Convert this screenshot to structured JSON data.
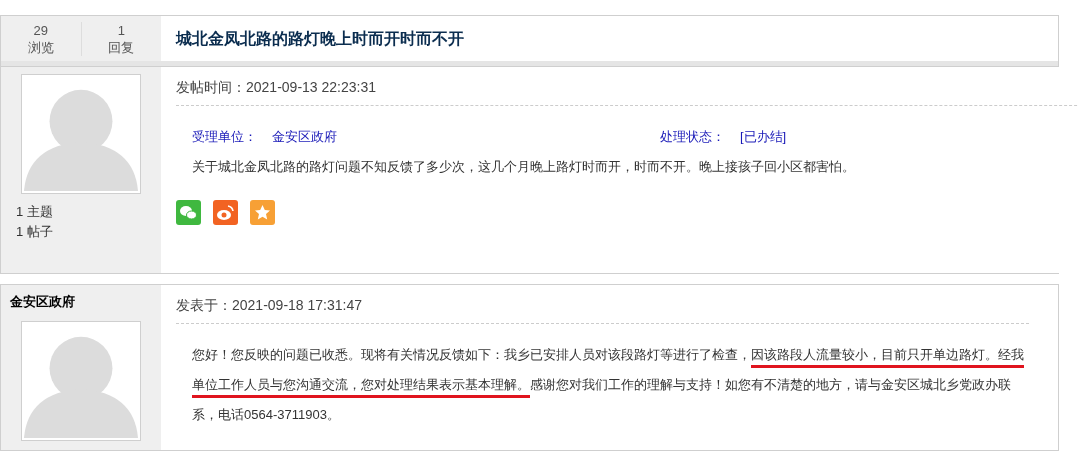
{
  "topic": {
    "stats": [
      {
        "value": "29",
        "label": "浏览"
      },
      {
        "value": "1",
        "label": "回复"
      }
    ],
    "title": "城北金凤北路的路灯晚上时而开时而不开"
  },
  "posts": [
    {
      "author_stats": [
        "1 主题",
        "1 帖子"
      ],
      "time": "发帖时间：2021-09-13 22:23:31",
      "fields": [
        {
          "label": "受理单位：",
          "value": "金安区政府"
        },
        {
          "label": "处理状态：",
          "value": "[已办结]"
        }
      ],
      "body": [
        {
          "text": "关于城北金凤北路的路灯问题不知反馈了多少次，这几个月晚上路灯时而开，时而不开。晚上接孩子回小区都害怕。",
          "highlighted": false
        }
      ],
      "share": true
    },
    {
      "author": "金安区政府",
      "time": "发表于：2021-09-18 17:31:47",
      "body": [
        {
          "text": "您好！您反映的问题已收悉。现将有关情况反馈如下：我乡已安排人员对该段路灯等进行了检查，",
          "highlighted": false
        },
        {
          "text": "因该路段人流量较小，目前只开单边路灯。经我单位工作人员与您沟通交流，您对处理结果表示基本理解。",
          "highlighted": true
        },
        {
          "text": "感谢您对我们工作的理解与支持！如您有不清楚的地方，请与金安区城北乡党政办联系，电话0564-3711903。",
          "highlighted": false
        }
      ],
      "share": false
    }
  ]
}
